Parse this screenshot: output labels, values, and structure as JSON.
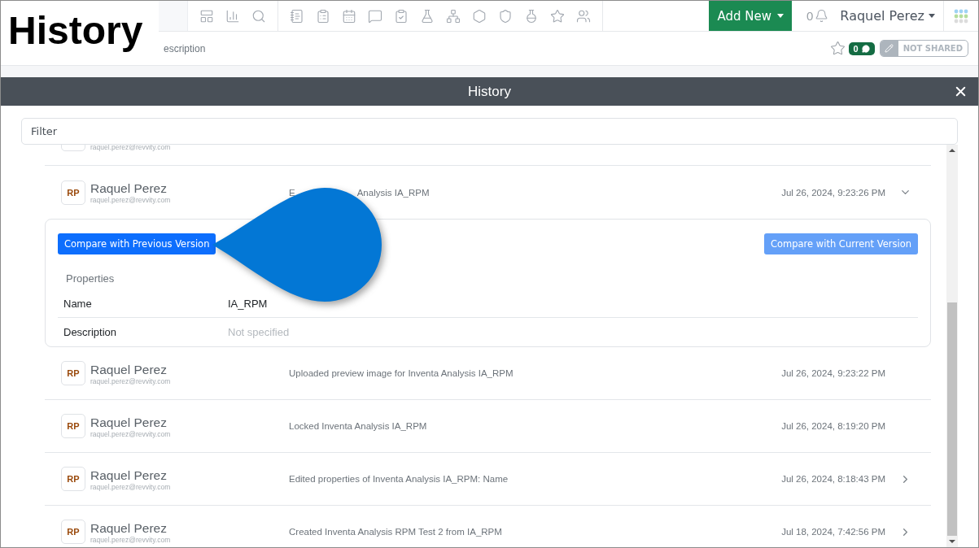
{
  "caption": "History",
  "navbar": {
    "add_button": "Add New",
    "notification_count": "0",
    "user": "Raquel Perez"
  },
  "subbar": {
    "breadcrumb": "escription",
    "starred": false,
    "comment_count": "0",
    "share_status": "NOT SHARED"
  },
  "modal": {
    "title": "History",
    "filter": {
      "placeholder": "Filter"
    },
    "partial_row": {
      "email": "raquel.perez@revvity.com"
    },
    "entries": [
      {
        "initials": "RP",
        "name": "Raquel Perez",
        "email": "raquel.perez@revvity.com",
        "description_parts": [
          "E",
          "Analysis IA_RPM"
        ],
        "time": "Jul 26, 2024, 9:23:26 PM",
        "expandable": true,
        "expanded": true,
        "details": {
          "buttons": [
            {
              "label": "Compare with Previous Version",
              "disabled": false
            },
            {
              "label": "Compare with Current Version",
              "disabled": true
            }
          ],
          "properties_title": "Properties",
          "properties": [
            {
              "name": "Name",
              "value": "IA_RPM"
            },
            {
              "name": "Description",
              "placeholder": "Not specified"
            }
          ]
        }
      },
      {
        "initials": "RP",
        "name": "Raquel Perez",
        "email": "raquel.perez@revvity.com",
        "description": "Uploaded preview image for Inventa Analysis IA_RPM",
        "time": "Jul 26, 2024, 9:23:22 PM",
        "expandable": false,
        "expanded": false
      },
      {
        "initials": "RP",
        "name": "Raquel Perez",
        "email": "raquel.perez@revvity.com",
        "description": "Locked Inventa Analysis IA_RPM",
        "time": "Jul 26, 2024, 8:19:20 PM",
        "expandable": false,
        "expanded": false
      },
      {
        "initials": "RP",
        "name": "Raquel Perez",
        "email": "raquel.perez@revvity.com",
        "description": "Edited properties of Inventa Analysis IA_RPM: Name",
        "time": "Jul 26, 2024, 8:18:43 PM",
        "expandable": true,
        "expanded": false
      },
      {
        "initials": "RP",
        "name": "Raquel Perez",
        "email": "raquel.perez@revvity.com",
        "description": "Created Inventa Analysis RPM Test 2 from IA_RPM",
        "time": "Jul 18, 2024, 7:42:56 PM",
        "expandable": true,
        "expanded": false
      }
    ]
  }
}
